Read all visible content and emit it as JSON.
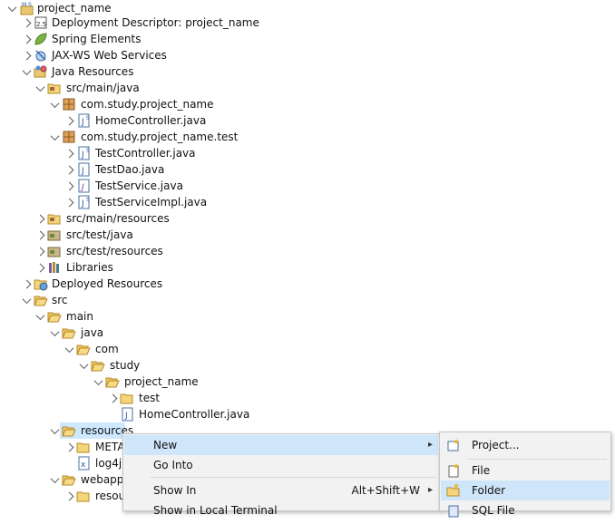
{
  "tree": {
    "project": "project_name",
    "items": [
      "Deployment Descriptor: project_name",
      "Spring Elements",
      "JAX-WS Web Services",
      "Java Resources",
      "src/main/java",
      "com.study.project_name",
      "HomeController.java",
      "com.study.project_name.test",
      "TestController.java",
      "TestDao.java",
      "TestService.java",
      "TestServiceImpl.java",
      "src/main/resources",
      "src/test/java",
      "src/test/resources",
      "Libraries",
      "Deployed Resources",
      "src",
      "main",
      "java",
      "com",
      "study",
      "project_name",
      "test",
      "HomeController.java",
      "resources",
      "META",
      "log4j",
      "webapp",
      "resou"
    ]
  },
  "menu": {
    "new": "New",
    "go_into": "Go Into",
    "show_in": "Show In",
    "show_in_shortcut": "Alt+Shift+W",
    "show_in_terminal": "Show in Local Terminal"
  },
  "submenu": {
    "project": "Project...",
    "file": "File",
    "folder": "Folder",
    "sql_file": "SQL File"
  }
}
